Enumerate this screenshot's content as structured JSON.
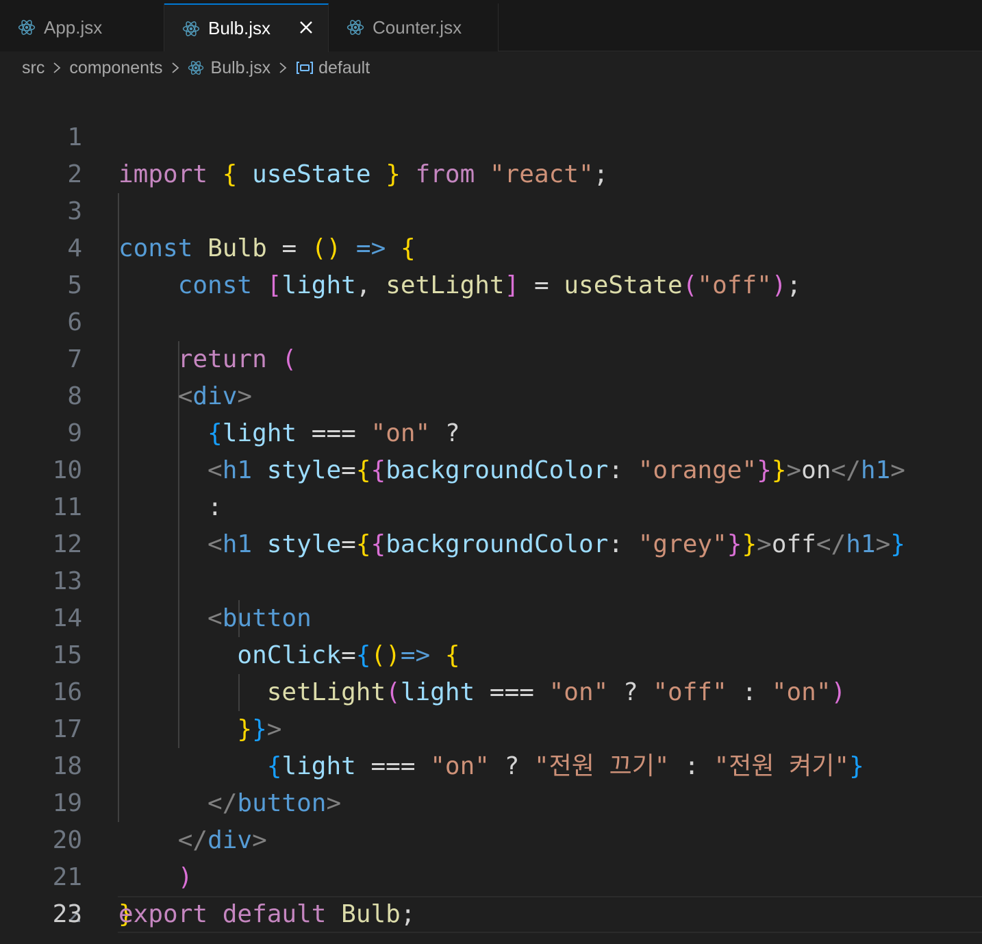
{
  "tabs": [
    {
      "label": "App.jsx",
      "icon": "react-icon",
      "active": false
    },
    {
      "label": "Bulb.jsx",
      "icon": "react-icon",
      "active": true,
      "close_icon": "close-icon"
    },
    {
      "label": "Counter.jsx",
      "icon": "react-icon",
      "active": false
    }
  ],
  "breadcrumb": {
    "parts": [
      "src",
      "components",
      "Bulb.jsx",
      "default"
    ],
    "icons": [
      "chevron-right-icon",
      "react-icon",
      "symbol-variable-icon"
    ]
  },
  "editor": {
    "current_line": 23,
    "line_numbers": [
      "1",
      "2",
      "3",
      "4",
      "5",
      "6",
      "7",
      "8",
      "9",
      "10",
      "11",
      "12",
      "13",
      "14",
      "15",
      "16",
      "17",
      "18",
      "19",
      "20",
      "21",
      "22",
      "23"
    ],
    "tokens": {
      "l1": [
        "import",
        "{",
        "useState",
        "}",
        "from",
        "\"react\"",
        ";"
      ],
      "l3": [
        "const",
        "Bulb",
        "=",
        "(",
        ")",
        "=>",
        "{"
      ],
      "l4": [
        "const",
        "[",
        "light",
        ",",
        "setLight",
        "]",
        "=",
        "useState",
        "(",
        "\"off\"",
        ")",
        ";"
      ],
      "l6": [
        "return",
        "("
      ],
      "l7": [
        "<",
        "div",
        ">"
      ],
      "l8": [
        "{",
        "light",
        "===",
        "\"on\"",
        "?"
      ],
      "l9": [
        "<",
        "h1",
        "style",
        "=",
        "{",
        "{",
        "backgroundColor",
        ":",
        "\"orange\"",
        "}",
        "}",
        ">",
        "on",
        "</",
        "h1",
        ">"
      ],
      "l10": [
        ":"
      ],
      "l11": [
        "<",
        "h1",
        "style",
        "=",
        "{",
        "{",
        "backgroundColor",
        ":",
        "\"grey\"",
        "}",
        "}",
        ">",
        "off",
        "</",
        "h1",
        ">",
        "}"
      ],
      "l13": [
        "<",
        "button"
      ],
      "l14": [
        "onClick",
        "=",
        "{",
        "(",
        ")",
        "=>",
        "{"
      ],
      "l15": [
        "setLight",
        "(",
        "light",
        "===",
        "\"on\"",
        "?",
        "\"off\"",
        ":",
        "\"on\"",
        ")"
      ],
      "l16": [
        "}",
        "}",
        ">"
      ],
      "l17": [
        "{",
        "light",
        "===",
        "\"on\"",
        "?",
        "\"전원 끄기\"",
        ":",
        "\"전원 켜기\"",
        "}"
      ],
      "l18": [
        "</",
        "button",
        ">"
      ],
      "l19": [
        "</",
        "div",
        ">"
      ],
      "l20": [
        ")"
      ],
      "l21": [
        "}"
      ],
      "l23": [
        "export",
        "default",
        "Bulb",
        ";"
      ]
    }
  },
  "colors": {
    "background": "#1f1f1f",
    "tabbar": "#181818",
    "active_tab_border": "#0078d4",
    "keyword_storage": "#569cd6",
    "keyword_control": "#c586c0",
    "function": "#dcdcaa",
    "variable": "#9cdcfe",
    "string": "#ce9178",
    "bracket_level1": "#ffd700",
    "bracket_level2": "#da70d6",
    "bracket_level3": "#179fff"
  }
}
